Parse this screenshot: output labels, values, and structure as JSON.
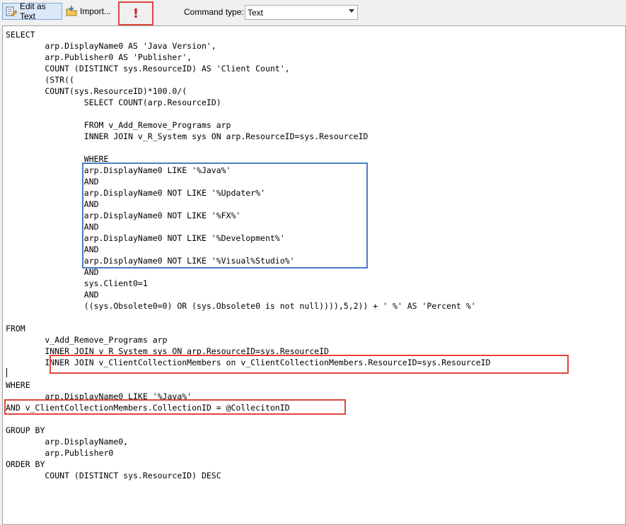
{
  "toolbar": {
    "edit_as_text": "Edit as Text",
    "import": "Import...",
    "run_icon": "!",
    "command_type_label": "Command type:",
    "command_type_value": "Text"
  },
  "editor": {
    "sql": "SELECT\n        arp.DisplayName0 AS 'Java Version',\n        arp.Publisher0 AS 'Publisher',\n        COUNT (DISTINCT sys.ResourceID) AS 'Client Count',\n        (STR((\n        COUNT(sys.ResourceID)*100.0/(\n                SELECT COUNT(arp.ResourceID)\n\n                FROM v_Add_Remove_Programs arp\n                INNER JOIN v_R_System sys ON arp.ResourceID=sys.ResourceID\n\n                WHERE\n                arp.DisplayName0 LIKE '%Java%'\n                AND\n                arp.DisplayName0 NOT LIKE '%Updater%'\n                AND\n                arp.DisplayName0 NOT LIKE '%FX%'\n                AND\n                arp.DisplayName0 NOT LIKE '%Development%'\n                AND\n                arp.DisplayName0 NOT LIKE '%Visual%Studio%'\n                AND\n                sys.Client0=1\n                AND\n                ((sys.Obsolete0=0) OR (sys.Obsolete0 is not null)))),5,2)) + ' %' AS 'Percent %'\n\nFROM\n        v_Add_Remove_Programs arp\n        INNER JOIN v_R_System sys ON arp.ResourceID=sys.ResourceID\n        INNER JOIN v_ClientCollectionMembers on v_ClientCollectionMembers.ResourceID=sys.ResourceID\n\nWHERE\n        arp.DisplayName0 LIKE '%Java%'\nAND v_ClientCollectionMembers.CollectionID = @CollecitonID\n\nGROUP BY\n        arp.DisplayName0,\n        arp.Publisher0\nORDER BY\n        COUNT (DISTINCT sys.ResourceID) DESC"
  },
  "colors": {
    "highlight_red": "#e0453f",
    "highlight_blue": "#4a7bc4"
  },
  "icons": [
    "edit-as-text-icon",
    "import-icon",
    "run-icon",
    "chevron-down-icon"
  ]
}
